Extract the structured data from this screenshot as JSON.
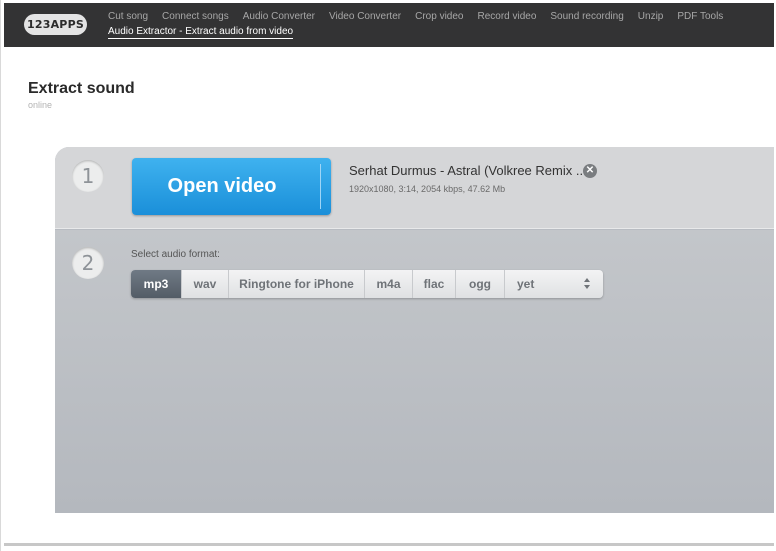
{
  "header": {
    "logo": "123APPS",
    "nav_items": [
      "Cut song",
      "Connect songs",
      "Audio Converter",
      "Video Converter",
      "Crop video",
      "Record video",
      "Sound recording",
      "Unzip",
      "PDF Tools"
    ],
    "active_item": "Audio Extractor - Extract audio from video"
  },
  "page": {
    "title": "Extract sound",
    "subtitle": "online"
  },
  "step1": {
    "number": "1",
    "open_button": "Open video",
    "file_name": "Serhat Durmus - Astral (Volkree Remix ...",
    "file_meta": "1920x1080, 3:14, 2054 kbps, 47.62 Mb",
    "remove_icon": "close-circle-icon"
  },
  "step2": {
    "number": "2",
    "label": "Select audio format:",
    "formats": [
      "mp3",
      "wav",
      "Ringtone for iPhone",
      "m4a",
      "flac",
      "ogg"
    ],
    "selected_format": "mp3",
    "more_select_value": "yet"
  },
  "colors": {
    "topbar": "#333334",
    "open_button": "#2aa0e6",
    "active_format": "#5f6872",
    "panel": "#b8bcc2"
  }
}
